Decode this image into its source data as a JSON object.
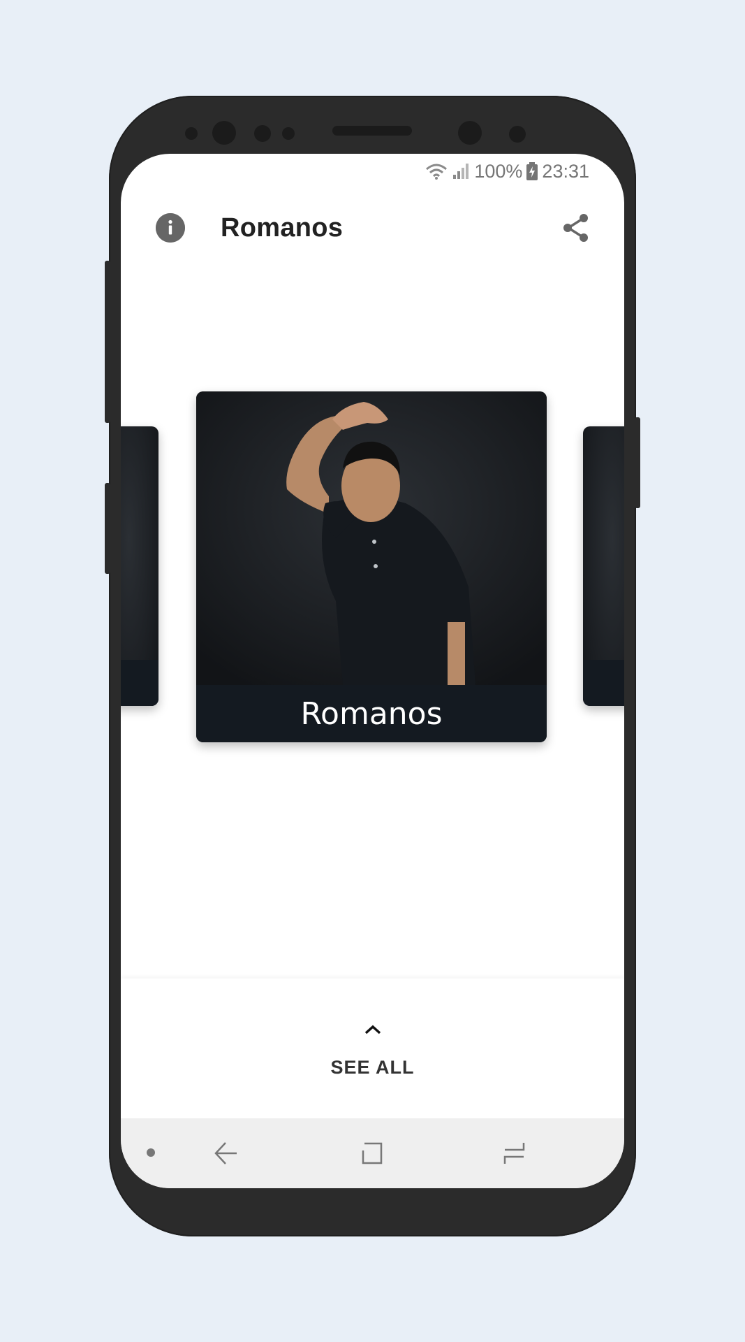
{
  "status_bar": {
    "battery": "100%",
    "time": "23:31"
  },
  "app_bar": {
    "title": "Romanos"
  },
  "carousel": {
    "main_card_caption": "Romanos"
  },
  "bottom_sheet": {
    "see_all_label": "SEE ALL"
  },
  "colors": {
    "background": "#e8eff7",
    "phone_frame": "#2b2b2b",
    "card_caption_bg": "#141a21",
    "nav_bar": "#efefef"
  }
}
